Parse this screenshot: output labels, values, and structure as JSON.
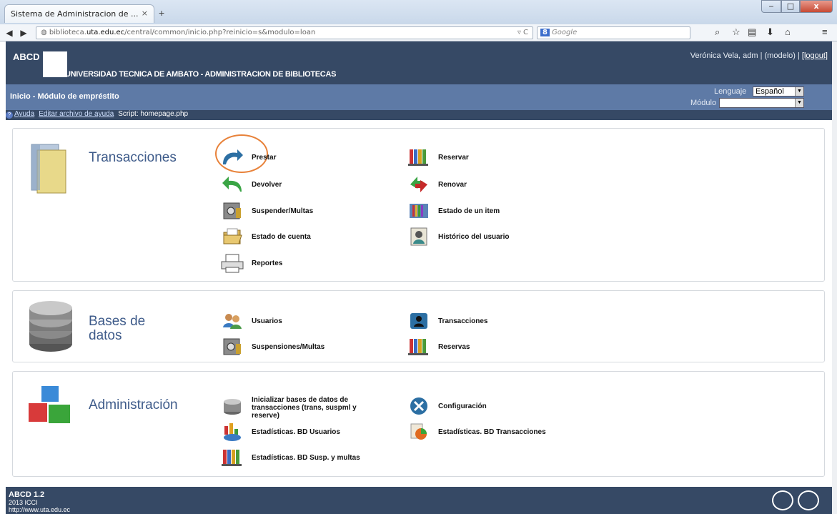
{
  "browser": {
    "tab_title": "Sistema de Administracion de ...",
    "tab_close": "×",
    "new_tab": "+",
    "url_prefix": "biblioteca.",
    "url_domain": "uta.edu.ec",
    "url_rest": "/central/common/inicio.php?reinicio=s&modulo=loan",
    "search_engine": "8",
    "search_placeholder": "Google"
  },
  "header": {
    "logo": "ABCD",
    "university": "UNIVERSIDAD TECNICA DE AMBATO - ADMINISTRACION DE BIBLIOTECAS",
    "user_text": "Verónica Vela, adm | (modelo) | ",
    "logout": "[logout]"
  },
  "subheader": {
    "module_title": "Inicio - Módulo de empréstito",
    "lang_label": "Lenguaje",
    "lang_value": "Español",
    "module_label": "Módulo",
    "module_value": ""
  },
  "helpbar": {
    "help": "Ayuda",
    "edit_help": "Editar archivo de ayuda",
    "script": "Script: homepage.php"
  },
  "sections": {
    "transacciones": {
      "title": "Transacciones",
      "items": [
        "Prestar",
        "Reservar",
        "Devolver",
        "Renovar",
        "Suspender/Multas",
        "Estado de un item",
        "Estado de cuenta",
        "Histórico del usuario",
        "Reportes"
      ]
    },
    "bases": {
      "title_line1": "Bases de",
      "title_line2": "datos",
      "items": [
        "Usuarios",
        "Transacciones",
        "Suspensiones/Multas",
        "Reservas"
      ]
    },
    "admin": {
      "title": "Administración",
      "items": [
        "Inicializar bases de datos de transacciones (trans, suspml y reserve)",
        "Configuración",
        "Estadísticas. BD Usuarios",
        "Estadísticas. BD Transacciones",
        "Estadísticas. BD Susp. y multas"
      ]
    }
  },
  "footer": {
    "version": "ABCD 1.2",
    "year": "2013 ICCI",
    "url": "http://www.uta.edu.ec"
  },
  "colors": {
    "header_bg": "#364965",
    "subheader_bg": "#5e7aa6",
    "section_title": "#3e5b8a",
    "highlight_circle": "#e8823a"
  }
}
